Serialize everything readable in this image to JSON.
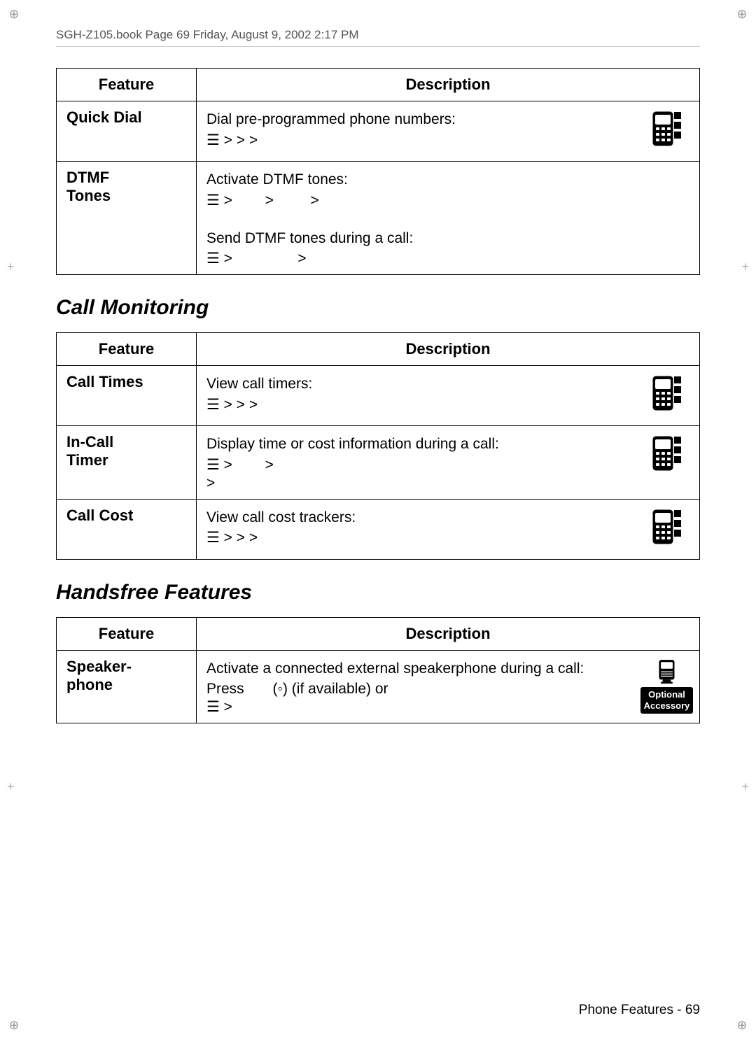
{
  "header": {
    "text": "SGH-Z105.book  Page 69  Friday, August 9, 2002  2:17 PM"
  },
  "table1": {
    "col1_header": "Feature",
    "col2_header": "Description",
    "rows": [
      {
        "feature": "Quick Dial",
        "desc_main": "Dial pre-programmed phone numbers:",
        "menu_line": "☰ >     >       >",
        "has_phone_icon": true
      },
      {
        "feature": "DTMF Tones",
        "desc_lines": [
          "Activate DTMF tones:",
          "☰ >     >       >",
          "Send DTMF tones during a call:",
          "☰ >"
        ],
        "has_phone_icon": false
      }
    ]
  },
  "section1": {
    "heading": "Call Monitoring"
  },
  "table2": {
    "col1_header": "Feature",
    "col2_header": "Description",
    "rows": [
      {
        "feature": "Call Times",
        "desc_main": "View call timers:",
        "menu_line": "☰ >     >       >",
        "has_phone_icon": true
      },
      {
        "feature": "In-Call Timer",
        "desc_lines": [
          "Display time or cost information during a call:",
          "☰ >     >",
          ">"
        ],
        "has_phone_icon": true
      },
      {
        "feature": "Call Cost",
        "desc_main": "View call cost trackers:",
        "menu_line": "☰ >     >       >",
        "has_phone_icon": true
      }
    ]
  },
  "section2": {
    "heading": "Handsfree Features"
  },
  "table3": {
    "col1_header": "Feature",
    "col2_header": "Description",
    "rows": [
      {
        "feature": "Speaker-\nphone",
        "desc_lines": [
          "Activate a connected external speakerphone during a call:",
          "Press        (◦) (if available) or",
          "☰ >"
        ],
        "has_speaker_icon": true,
        "optional_text": "Optional\nAccessory"
      }
    ]
  },
  "footer": {
    "text": "Phone Features - 69"
  }
}
